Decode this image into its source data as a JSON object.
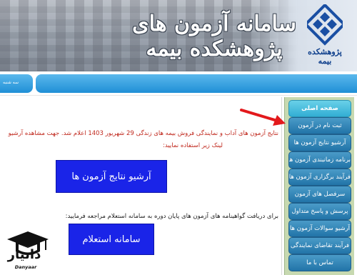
{
  "header": {
    "title": "سامانه آزمون های پژوهشکده بیمه",
    "logo_text": "پژوهشکده بیمه",
    "logo_icon": "insurance-research-logo"
  },
  "navbar": {
    "left_text": "سه شنبه"
  },
  "sidebar": {
    "items": [
      {
        "label": "صفحه اصلی"
      },
      {
        "label": "ثبت نام در آزمون"
      },
      {
        "label": "آرشیو نتایج آزمون ها"
      },
      {
        "label": "برنامه زمانبندی آزمون ها"
      },
      {
        "label": "فرآیند برگزاری آزمون ها"
      },
      {
        "label": "سرفصل های آزمون"
      },
      {
        "label": "پرسش و پاسخ متداول"
      },
      {
        "label": "آرشیو سوالات آزمون ها"
      },
      {
        "label": "فرآیند تقاضای نمایندگی"
      },
      {
        "label": "تماس با ما"
      }
    ]
  },
  "main": {
    "notice_line1": "نتایج آزمون های آداب و نمایندگی فروش بیمه های زندگی 29 شهریور 1403 اعلام شد. جهت مشاهده آرشیو",
    "notice_line2": "لینک زیر استفاده نمایید:",
    "archive_button": "آرشیو نتایج آزمون ها",
    "certificate_text": "برای دریافت گواهینامه های آزمون های پایان دوره به سامانه استعلام مراجعه فرمایید:",
    "inquiry_button": "سامانه استعلام"
  },
  "watermark": {
    "brand": "دانیار",
    "sub": "Danyaar"
  },
  "colors": {
    "nav_blue": "#1f8fd6",
    "sidebar_bg": "#c7d9b0",
    "button_blue": "#1a24e8",
    "notice_red": "#c0281d"
  }
}
